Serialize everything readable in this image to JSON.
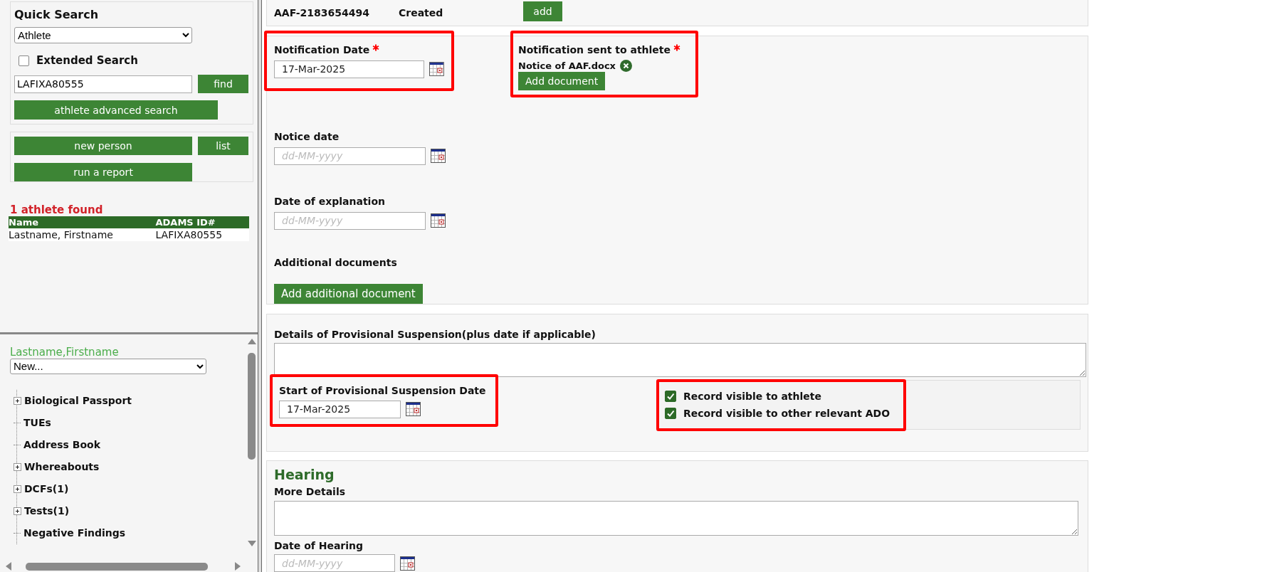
{
  "quick_search": {
    "title": "Quick Search",
    "search_type": "Athlete",
    "extended_search": {
      "label": "Extended Search",
      "checked": false
    },
    "query": "LAFIXA80555",
    "find_button": "find",
    "advanced_button": "athlete advanced search"
  },
  "actions": {
    "new_person": "new person",
    "list": "list",
    "report": "run a report"
  },
  "results": {
    "summary": "1 athlete found",
    "columns": [
      "Name",
      "ADAMS ID#"
    ],
    "rows": [
      [
        "Lastname, Firstname",
        "LAFIXA80555"
      ]
    ]
  },
  "athlete": {
    "name": "Lastname,Firstname",
    "menu": "New...",
    "tree": [
      {
        "label": "Biological Passport",
        "expandable": true
      },
      {
        "label": "TUEs",
        "expandable": false
      },
      {
        "label": "Address Book",
        "expandable": false
      },
      {
        "label": "Whereabouts",
        "expandable": true
      },
      {
        "label": "DCFs(1)",
        "expandable": true
      },
      {
        "label": "Tests(1)",
        "expandable": true
      },
      {
        "label": "Negative Findings",
        "expandable": false
      }
    ]
  },
  "case_header": {
    "id": "AAF-2183654494",
    "status": "Created",
    "button": "add"
  },
  "notification": {
    "notification_date": {
      "label": "Notification Date",
      "value": "17-Mar-2025",
      "required": true,
      "highlighted": true
    },
    "notice_date": {
      "label": "Notice date",
      "placeholder": "dd-MM-yyyy"
    },
    "explanation_date": {
      "label": "Date of explanation",
      "placeholder": "dd-MM-yyyy"
    },
    "additional_documents": {
      "label": "Additional documents",
      "button": "Add additional document"
    },
    "notification_sent": {
      "label": "Notification sent to athlete",
      "required": true,
      "highlighted": true,
      "document": "Notice of AAF.docx",
      "button": "Add document"
    }
  },
  "suspension": {
    "details_label": "Details of Provisional Suspension(plus date if applicable)",
    "start_date": {
      "label": "Start of Provisional Suspension Date",
      "value": "17-Mar-2025",
      "highlighted": true
    },
    "visibility": {
      "highlighted": true,
      "options": [
        {
          "label": "Record visible to athlete",
          "checked": true
        },
        {
          "label": "Record visible to other relevant ADO",
          "checked": true
        }
      ]
    }
  },
  "hearing": {
    "title": "Hearing",
    "details_label": "More Details",
    "date": {
      "label": "Date of Hearing",
      "placeholder": "dd-MM-yyyy"
    }
  }
}
